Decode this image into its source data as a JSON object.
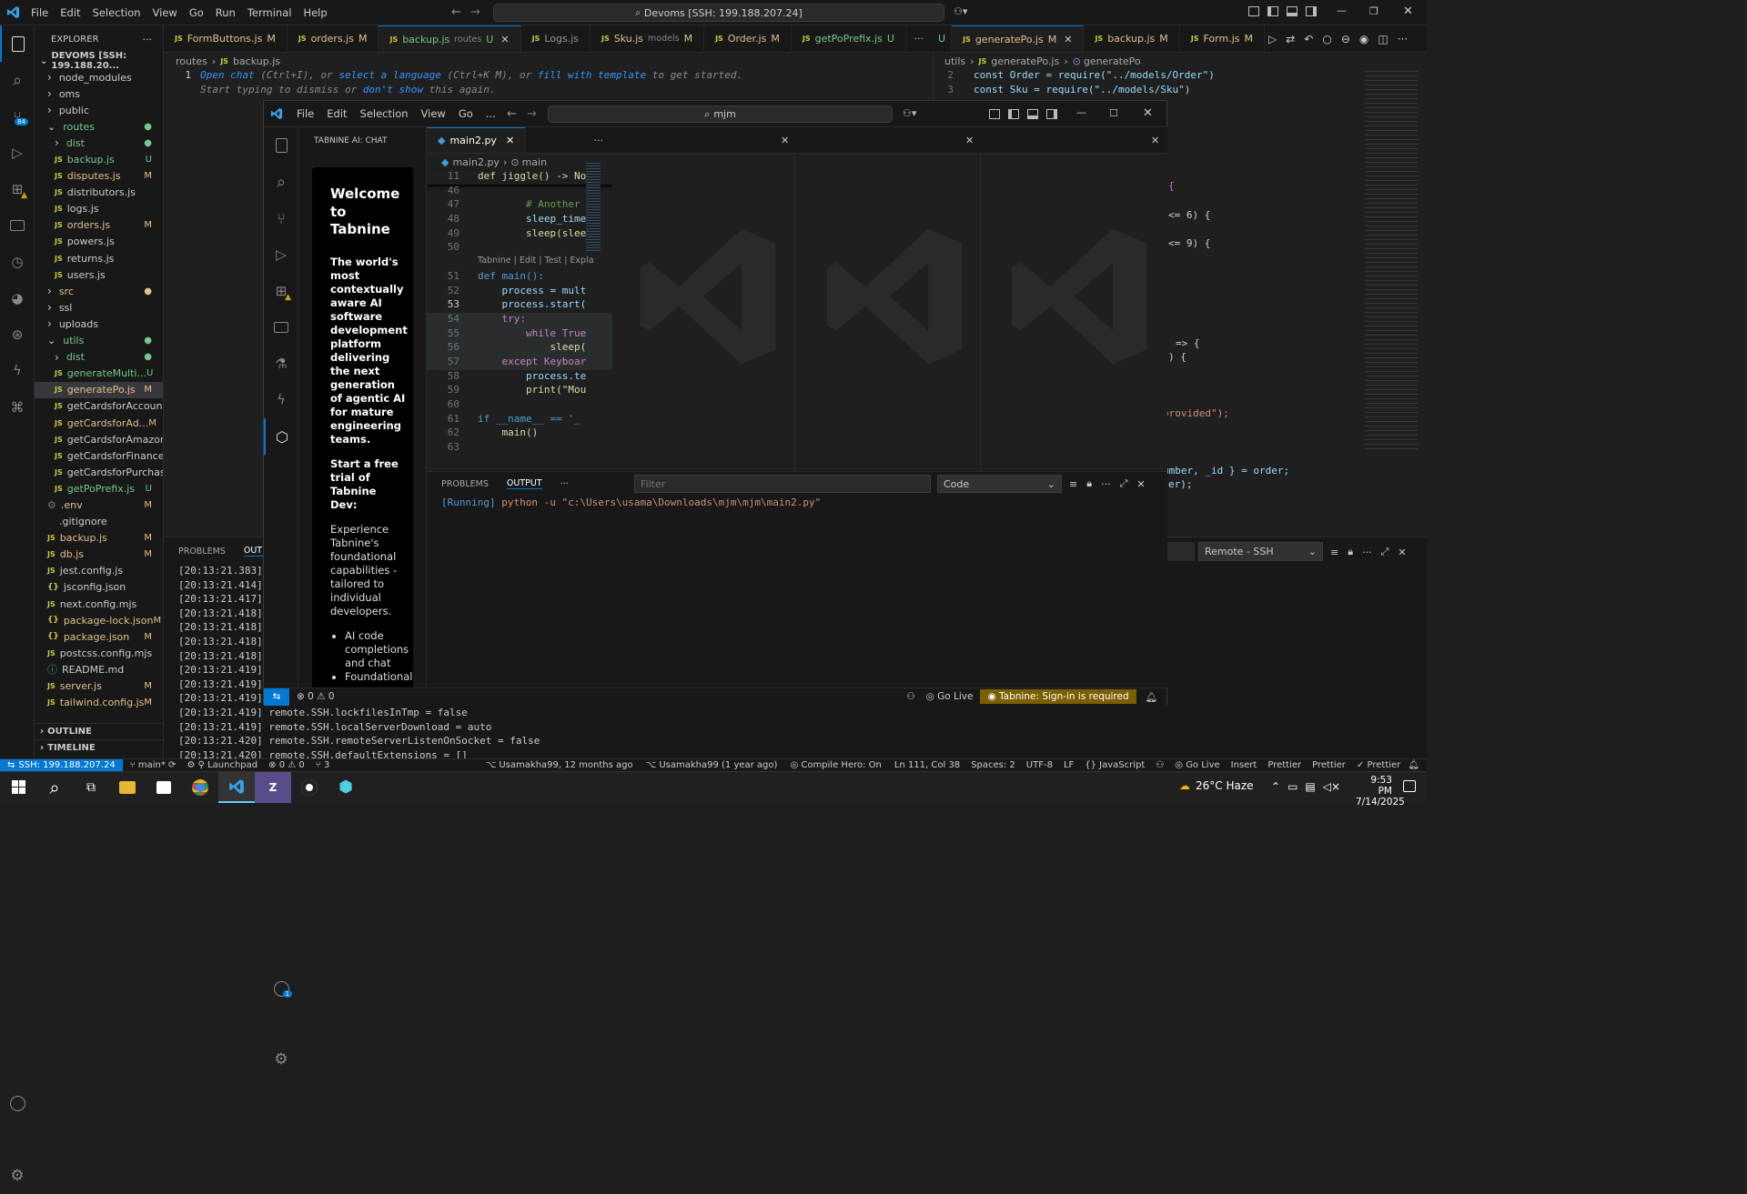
{
  "titlebar": {
    "menus": [
      "File",
      "Edit",
      "Selection",
      "View",
      "Go",
      "Run",
      "Terminal",
      "Help"
    ],
    "search": "Devoms [SSH: 199.188.207.24]"
  },
  "activity": {
    "source_badge": "84"
  },
  "explorer": {
    "header": "EXPLORER",
    "root": "DEVOMS [SSH: 199.188.20...",
    "items": [
      {
        "label": "node_modules",
        "kind": "folder",
        "indent": 1,
        "status": ""
      },
      {
        "label": "oms",
        "kind": "folder",
        "indent": 1,
        "status": ""
      },
      {
        "label": "public",
        "kind": "folder",
        "indent": 1,
        "status": ""
      },
      {
        "label": "routes",
        "kind": "folder-open",
        "indent": 1,
        "status": "●",
        "color": "#73c991"
      },
      {
        "label": "dist",
        "kind": "folder",
        "indent": 2,
        "status": "●",
        "color": "#73c991"
      },
      {
        "label": "backup.js",
        "kind": "js",
        "indent": 2,
        "status": "U",
        "color": "#73c991"
      },
      {
        "label": "disputes.js",
        "kind": "js",
        "indent": 2,
        "status": "M",
        "color": "#e2c08d"
      },
      {
        "label": "distributors.js",
        "kind": "js",
        "indent": 2,
        "status": ""
      },
      {
        "label": "logs.js",
        "kind": "js",
        "indent": 2,
        "status": ""
      },
      {
        "label": "orders.js",
        "kind": "js",
        "indent": 2,
        "status": "M",
        "color": "#e2c08d"
      },
      {
        "label": "powers.js",
        "kind": "js",
        "indent": 2,
        "status": ""
      },
      {
        "label": "returns.js",
        "kind": "js",
        "indent": 2,
        "status": ""
      },
      {
        "label": "users.js",
        "kind": "js",
        "indent": 2,
        "status": ""
      },
      {
        "label": "src",
        "kind": "folder",
        "indent": 1,
        "status": "●",
        "color": "#e2c08d"
      },
      {
        "label": "ssl",
        "kind": "folder",
        "indent": 1,
        "status": ""
      },
      {
        "label": "uploads",
        "kind": "folder",
        "indent": 1,
        "status": ""
      },
      {
        "label": "utils",
        "kind": "folder-open",
        "indent": 1,
        "status": "●",
        "color": "#73c991"
      },
      {
        "label": "dist",
        "kind": "folder",
        "indent": 2,
        "status": "●",
        "color": "#73c991"
      },
      {
        "label": "generateMulti...",
        "kind": "js",
        "indent": 2,
        "status": "U",
        "color": "#73c991"
      },
      {
        "label": "generatePo.js",
        "kind": "js",
        "indent": 2,
        "status": "M",
        "color": "#e2c08d",
        "selected": true
      },
      {
        "label": "getCardsforAccount.js",
        "kind": "js",
        "indent": 2,
        "status": ""
      },
      {
        "label": "getCardsforAd...",
        "kind": "js",
        "indent": 2,
        "status": "M",
        "color": "#e2c08d"
      },
      {
        "label": "getCardsforAmazon.js",
        "kind": "js",
        "indent": 2,
        "status": ""
      },
      {
        "label": "getCardsforFinance.js",
        "kind": "js",
        "indent": 2,
        "status": ""
      },
      {
        "label": "getCardsforPurchasi...",
        "kind": "js",
        "indent": 2,
        "status": ""
      },
      {
        "label": "getPoPrefix.js",
        "kind": "js",
        "indent": 2,
        "status": "U",
        "color": "#73c991"
      },
      {
        "label": ".env",
        "kind": "gear",
        "indent": 1,
        "status": "M",
        "color": "#e2c08d"
      },
      {
        "label": ".gitignore",
        "kind": "none",
        "indent": 1,
        "status": ""
      },
      {
        "label": "backup.js",
        "kind": "js",
        "indent": 1,
        "status": "M",
        "color": "#e2c08d"
      },
      {
        "label": "db.js",
        "kind": "js",
        "indent": 1,
        "status": "M",
        "color": "#e2c08d"
      },
      {
        "label": "jest.config.js",
        "kind": "js",
        "indent": 1,
        "status": ""
      },
      {
        "label": "jsconfig.json",
        "kind": "json",
        "indent": 1,
        "status": ""
      },
      {
        "label": "next.config.mjs",
        "kind": "js",
        "indent": 1,
        "status": ""
      },
      {
        "label": "package-lock.json",
        "kind": "json",
        "indent": 1,
        "status": "M",
        "color": "#e2c08d"
      },
      {
        "label": "package.json",
        "kind": "json",
        "indent": 1,
        "status": "M",
        "color": "#e2c08d"
      },
      {
        "label": "postcss.config.mjs",
        "kind": "js",
        "indent": 1,
        "status": ""
      },
      {
        "label": "README.md",
        "kind": "info",
        "indent": 1,
        "status": ""
      },
      {
        "label": "server.js",
        "kind": "js",
        "indent": 1,
        "status": "M",
        "color": "#e2c08d"
      },
      {
        "label": "tailwind.config.js",
        "kind": "js",
        "indent": 1,
        "status": "M",
        "color": "#e2c08d"
      }
    ],
    "outline": "OUTLINE",
    "timeline": "TIMELINE"
  },
  "tabs": [
    {
      "label": "FormButtons.js",
      "dir": "",
      "status": "M"
    },
    {
      "label": "orders.js",
      "dir": "",
      "status": "M"
    },
    {
      "label": "backup.js",
      "dir": "routes",
      "status": "U",
      "active": true
    },
    {
      "label": "Logs.js",
      "dir": "",
      "status": ""
    },
    {
      "label": "Sku.js",
      "dir": "models",
      "status": "M"
    },
    {
      "label": "Order.js",
      "dir": "",
      "status": "M"
    },
    {
      "label": "getPoPrefix.js",
      "dir": "",
      "status": "U"
    }
  ],
  "tabs_overflow": "U",
  "right_tabs": [
    {
      "label": "generatePo.js",
      "status": "M",
      "active": true
    },
    {
      "label": "backup.js",
      "status": "M"
    },
    {
      "label": "Form.js",
      "status": "M"
    }
  ],
  "editor_left": {
    "breadcrumb": [
      "routes",
      "backup.js"
    ],
    "line_no": "1",
    "hint": {
      "a": "Open chat",
      "b": " (Ctrl+I), or ",
      "c": "select a language",
      "d": " (Ctrl+K M), or ",
      "e": "fill with template",
      "f": " to get started.",
      "g": "Start typing to dismiss or ",
      "h": "don't show",
      "i": " this again."
    }
  },
  "editor_right": {
    "breadcrumb": [
      "utils",
      "generatePo.js",
      "generatePo"
    ],
    "lines": [
      {
        "n": "2",
        "code": "const Order = require(\"../models/Order\")"
      },
      {
        "n": "3",
        "code": "const Sku = require(\"../models/Sku\")"
      }
    ],
    "fragments": [
      "{",
      "<= 6) {",
      "<= 9) {",
      "=> {",
      ") {",
      "provided\");",
      "umber, _id } = order;",
      "er);"
    ]
  },
  "bottom_left": {
    "tabs": [
      "PROBLEMS",
      "OUTPU"
    ],
    "timestamps": [
      "[20:13:21.383]",
      "[20:13:21.414]",
      "[20:13:21.417]",
      "[20:13:21.418]",
      "[20:13:21.418]",
      "[20:13:21.418]",
      "[20:13:21.418]",
      "[20:13:21.419]",
      "[20:13:21.419]",
      "[20:13:21.419]"
    ],
    "full_lines": [
      "[20:13:21.419] remote.SSH.lockfilesInTmp = false",
      "[20:13:21.419] remote.SSH.localServerDownload = auto",
      "[20:13:21.420] remote.SSH.remoteServerListenOnSocket = false",
      "[20:13:21.420] remote.SSH.defaultExtensions = []"
    ],
    "dropdown": "Remote - SSH"
  },
  "statusbar": {
    "remote": "SSH: 199.188.207.24",
    "branch": "main*",
    "launchpad": "Launchpad",
    "errors": "0",
    "warnings": "0",
    "ports": "3",
    "blame1": "Usamakha99, 12 months ago",
    "blame2": "Usamakha99 (1 year ago)",
    "compile": "Compile Hero: On",
    "pos": "Ln 111, Col 38",
    "spaces": "Spaces: 2",
    "enc": "UTF-8",
    "eol": "LF",
    "lang": "JavaScript",
    "golive": "Go Live",
    "insert": "Insert",
    "prettier1": "Prettier",
    "prettier2": "Prettier",
    "prettier3": "Prettier"
  },
  "taskbar": {
    "weather": "26°C  Haze",
    "time": "9:53 PM",
    "date": "7/14/2025"
  },
  "win2": {
    "menus": [
      "File",
      "Edit",
      "Selection",
      "View",
      "Go",
      "..."
    ],
    "search": "mjm",
    "chat_title": "TABNINE AI: CHAT",
    "welcome": "Welcome to Tabnine",
    "tagline": "The world's most contextually aware AI software development platform delivering the next generation of agentic AI for mature engineering teams.",
    "trial": "Start a free trial of Tabnine Dev:",
    "experience": "Experience Tabnine's foundational capabilities - tailored to individual developers.",
    "bullets": [
      "AI code completions and chat",
      "Foundational"
    ],
    "tab": "main2.py",
    "breadcrumb": [
      "main2.py",
      "main"
    ],
    "sticky": {
      "n": "11",
      "code": "def jiggle() -> No"
    },
    "lens": "Tabnine | Edit | Test | Expla",
    "lines": [
      {
        "n": "46",
        "code": ""
      },
      {
        "n": "47",
        "code": "        # Another"
      },
      {
        "n": "48",
        "code": "        sleep_time"
      },
      {
        "n": "49",
        "code": "        sleep(slee"
      },
      {
        "n": "50",
        "code": ""
      },
      {
        "n": "51",
        "code": "def main():"
      },
      {
        "n": "52",
        "code": "    process = mult"
      },
      {
        "n": "53",
        "code": "    process.start("
      },
      {
        "n": "54",
        "code": "    try:"
      },
      {
        "n": "55",
        "code": "        while True"
      },
      {
        "n": "56",
        "code": "            sleep("
      },
      {
        "n": "57",
        "code": "    except Keyboar"
      },
      {
        "n": "58",
        "code": "        process.te"
      },
      {
        "n": "59",
        "code": "        print(\"Mou"
      },
      {
        "n": "60",
        "code": ""
      },
      {
        "n": "61",
        "code": "if __name__ == '_"
      },
      {
        "n": "62",
        "code": "    main()"
      },
      {
        "n": "63",
        "code": ""
      }
    ],
    "panel_tabs": [
      "PROBLEMS",
      "OUTPUT"
    ],
    "filter_placeholder": "Filter",
    "channel": "Code",
    "running": "[Running]",
    "command": " python -u \"c:\\Users\\usama\\Downloads\\mjm\\mjm\\main2.py\"",
    "status": {
      "errors": "0",
      "warnings": "0",
      "golive": "Go Live",
      "tabnine": "Tabnine: Sign-in is required"
    },
    "account_badge": "1"
  }
}
